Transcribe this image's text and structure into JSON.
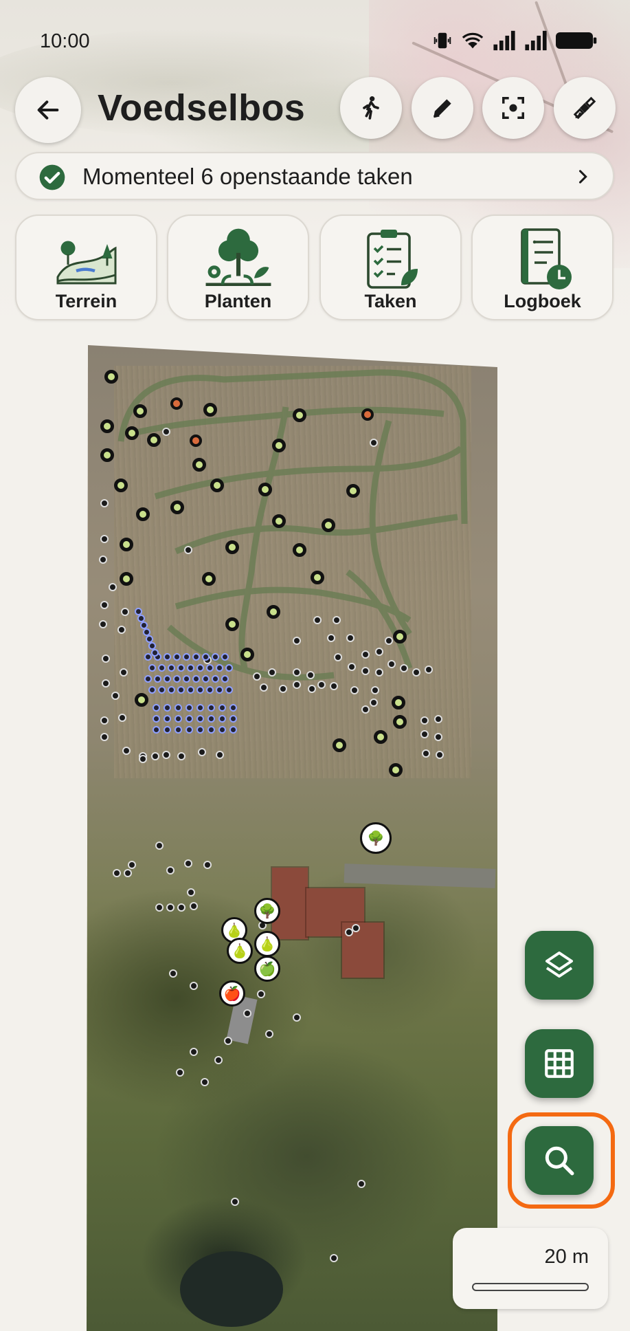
{
  "status_bar": {
    "time": "10:00"
  },
  "header": {
    "title": "Voedselbos"
  },
  "toolbar": {
    "back": "back-arrow-icon",
    "walk": "walking-person-icon",
    "edit": "pencil-icon",
    "focus": "focus-target-icon",
    "satellite": "satellite-icon"
  },
  "tasks_banner": {
    "text": "Momenteel 6 openstaande taken"
  },
  "tiles": [
    {
      "label": "Terrein",
      "icon": "terrain-icon"
    },
    {
      "label": "Planten",
      "icon": "plants-icon"
    },
    {
      "label": "Taken",
      "icon": "tasks-clipboard-icon"
    },
    {
      "label": "Logboek",
      "icon": "logbook-icon"
    }
  ],
  "map": {
    "type": "satellite"
  },
  "fabs": [
    {
      "icon": "layers-icon"
    },
    {
      "icon": "grid-icon"
    },
    {
      "icon": "search-icon"
    }
  ],
  "scale": {
    "label": "20 m"
  },
  "colors": {
    "primary": "#2d6a3e",
    "focus": "#f46a12",
    "surface": "#f3f1ec"
  }
}
